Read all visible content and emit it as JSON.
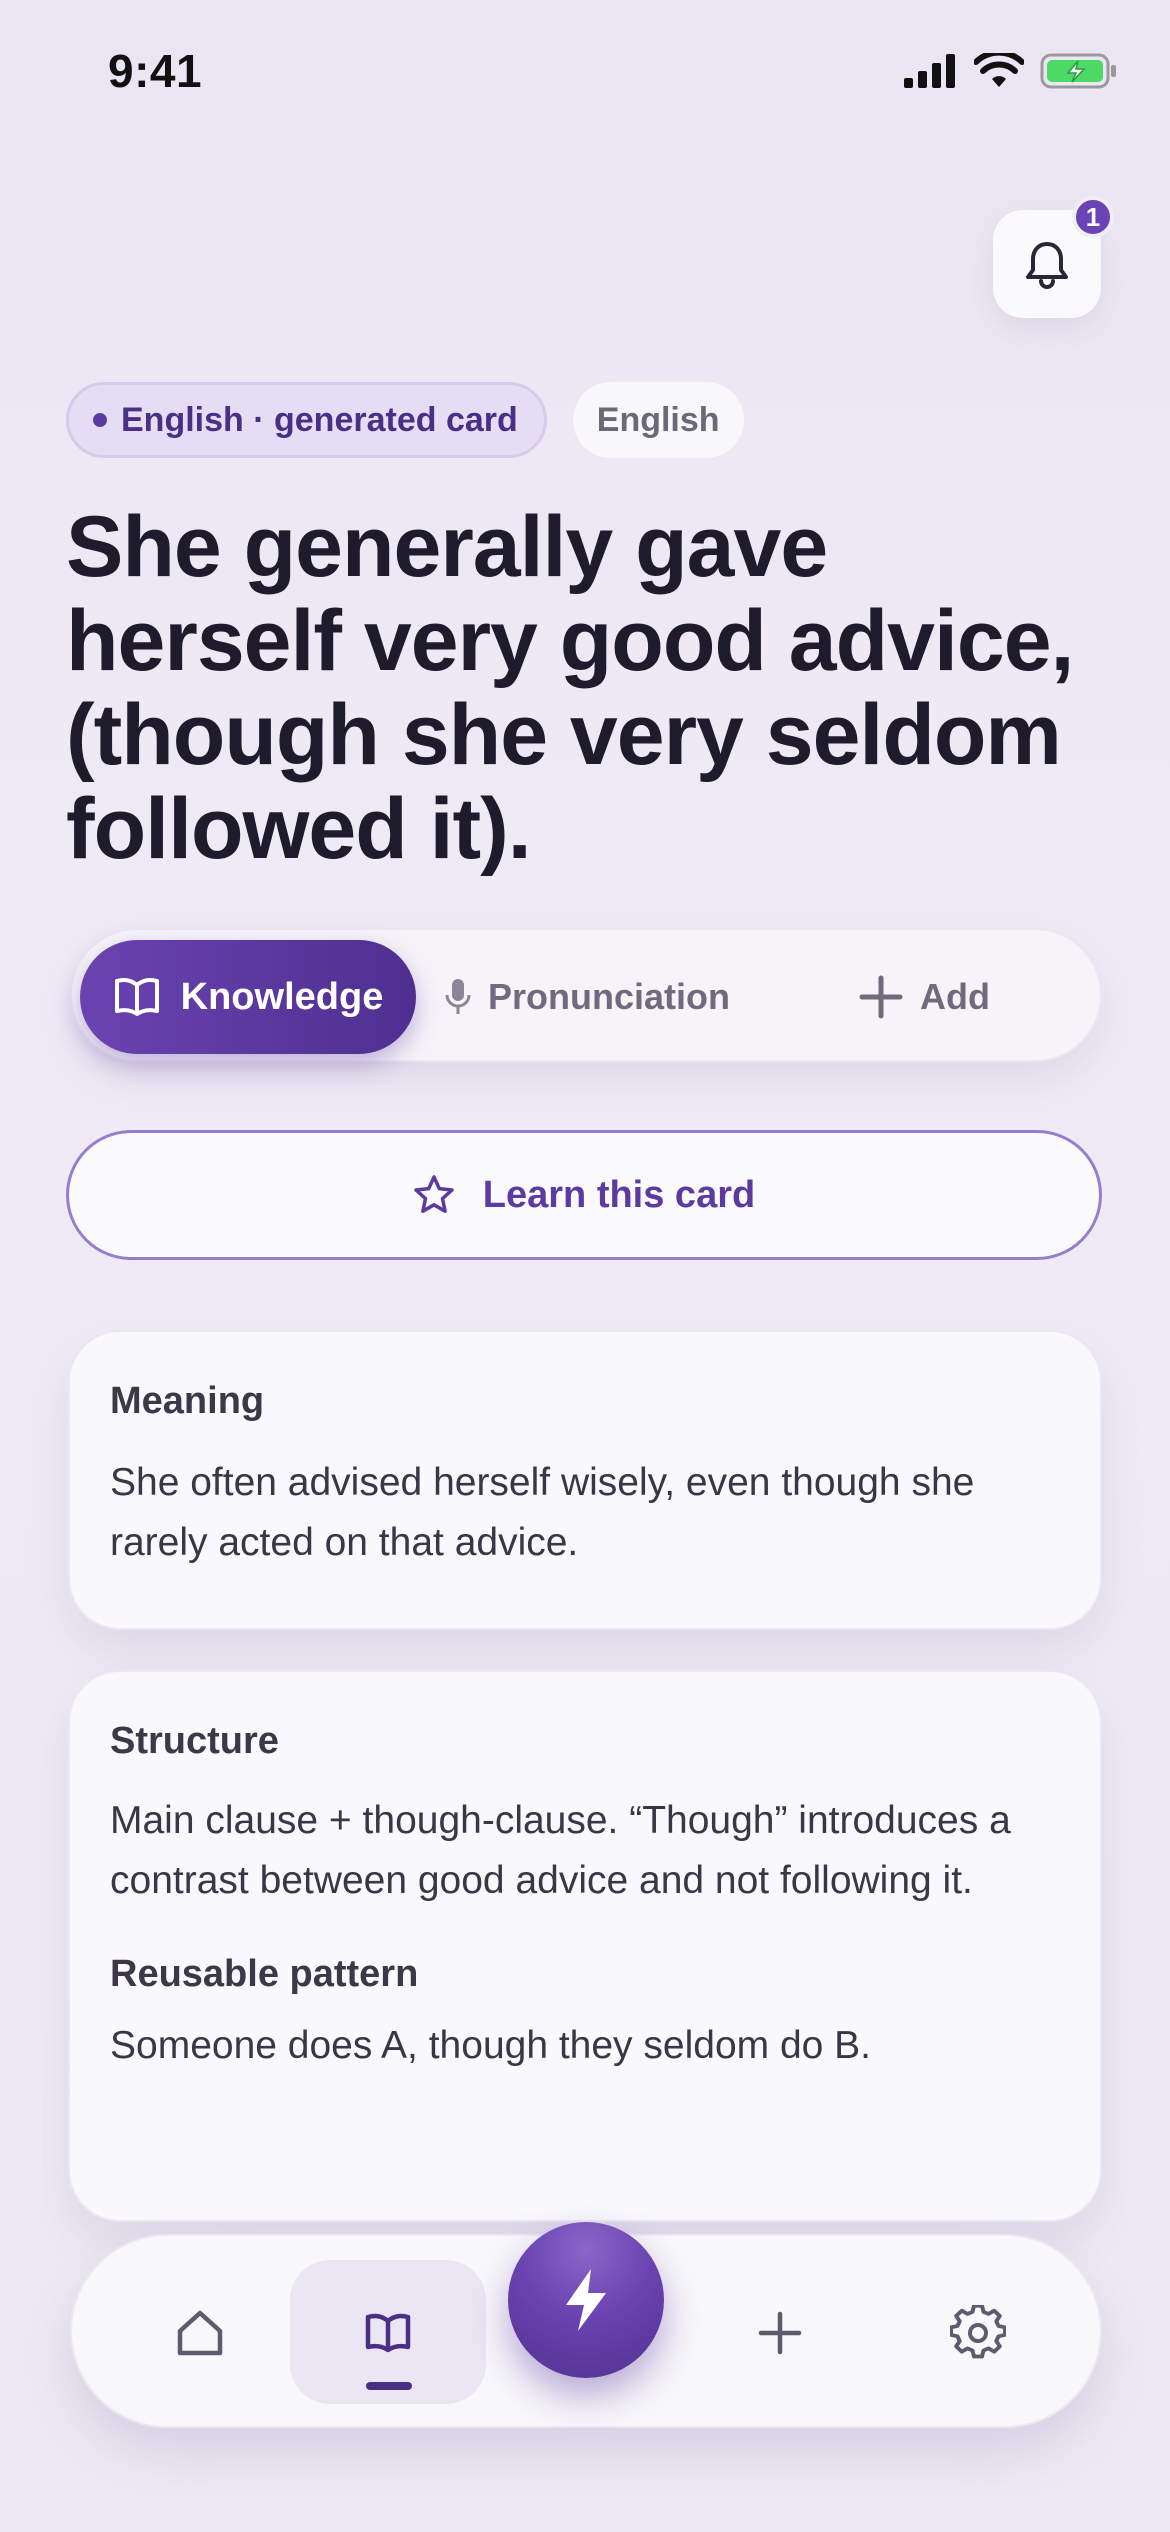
{
  "status_bar": {
    "time": "9:41",
    "icons": [
      "signal-icon",
      "wifi-icon",
      "battery-charging-icon"
    ]
  },
  "notifications": {
    "icon": "bell-icon",
    "badge_count": "1"
  },
  "chips": {
    "primary_label": "English · generated card",
    "secondary_label": "English"
  },
  "card_title": "She generally gave herself very good advice, (though she very seldom followed it).",
  "segmented_control": {
    "active": "Knowledge",
    "items": [
      {
        "label": "Knowledge",
        "icon": "book-open-icon"
      },
      {
        "label": "Pronunciation",
        "icon": "microphone-icon"
      },
      {
        "label": "Add",
        "icon": "plus-icon"
      }
    ]
  },
  "learn_button": {
    "label": "Learn this card",
    "icon": "star-icon"
  },
  "meaning_card": {
    "label": "Meaning",
    "text": "She often advised herself wisely, even though she rarely acted on that advice."
  },
  "structure_card": {
    "label": "Structure",
    "text": "Main clause + though-clause. “Though” introduces a contrast between good advice and not following it.",
    "pattern_label": "Reusable pattern",
    "pattern_text": "Someone does A, though they seldom do B."
  },
  "bottom_nav": {
    "active": "library",
    "items": [
      "home-icon",
      "book-open-icon",
      "lightning-icon",
      "plus-icon",
      "gear-icon"
    ]
  },
  "colors": {
    "accent": "#5b3aa1",
    "accent_dark": "#4e2f8f",
    "background": "#ece7f4",
    "card": "#f9f8fc",
    "battery_green": "#4cd964"
  }
}
